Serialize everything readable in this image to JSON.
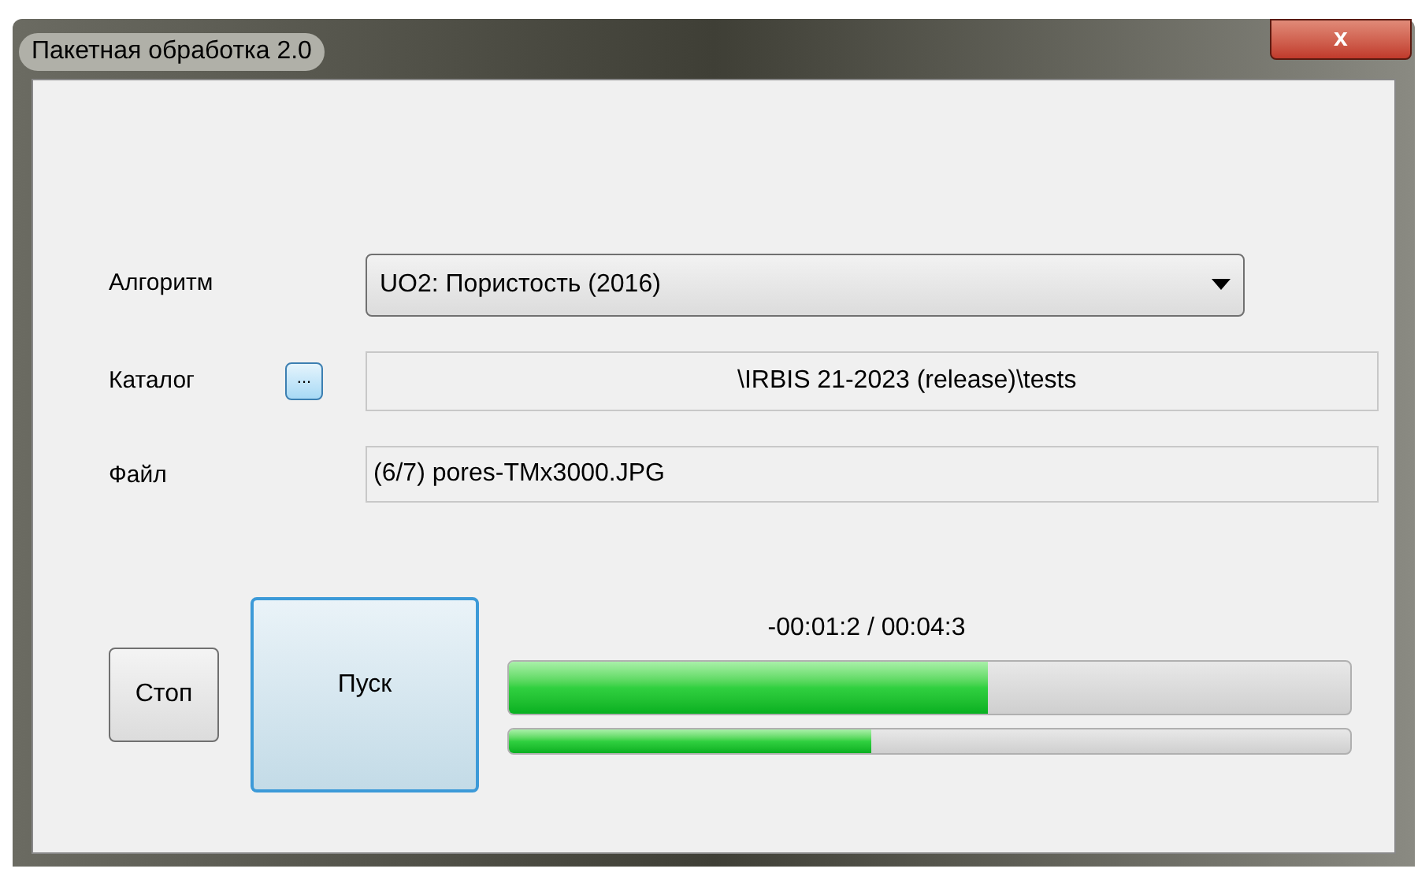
{
  "window": {
    "title": "Пакетная обработка 2.0",
    "close_label": "x"
  },
  "fields": [
    {
      "kind": "combo",
      "label": "Алгоритм",
      "value": "UO2: Пористость (2016)"
    },
    {
      "kind": "browse",
      "label": "Каталог",
      "button": "...",
      "value": "\\IRBIS 21-2023 (release)\\tests"
    },
    {
      "kind": "text",
      "label": "Файл",
      "value": "(6/7) pores-TMx3000.JPG"
    }
  ],
  "buttons": [
    {
      "label": "Стоп",
      "selected": false
    },
    {
      "label": "Пуск",
      "selected": true
    }
  ],
  "progress": {
    "time": "-00:01:2 / 00:04:3",
    "bars": [
      {
        "level": 0.57
      },
      {
        "level": 0.43
      }
    ]
  }
}
